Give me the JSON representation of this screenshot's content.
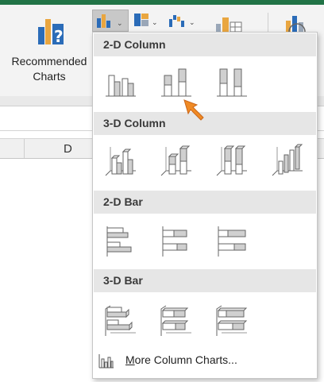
{
  "ribbon": {
    "recommended_line1": "Recommended",
    "recommended_line2": "Charts",
    "column_chart_caret": "⌄",
    "hierarchy_caret": "⌄",
    "waterfall_caret": "⌄"
  },
  "sheet": {
    "column_d": "D"
  },
  "dropdown": {
    "sections": [
      {
        "title": "2-D Column",
        "items": [
          "clustered-column-icon",
          "stacked-column-icon",
          "100-stacked-column-icon"
        ]
      },
      {
        "title": "3-D Column",
        "items": [
          "3d-clustered-column-icon",
          "3d-stacked-column-icon",
          "3d-100-stacked-column-icon",
          "3d-column-icon"
        ]
      },
      {
        "title": "2-D Bar",
        "items": [
          "clustered-bar-icon",
          "stacked-bar-icon",
          "100-stacked-bar-icon"
        ]
      },
      {
        "title": "3-D Bar",
        "items": [
          "3d-clustered-bar-icon",
          "3d-stacked-bar-icon",
          "3d-100-stacked-bar-icon"
        ]
      }
    ],
    "more_first_letter": "M",
    "more_rest": "ore Column Charts..."
  },
  "colors": {
    "brand": "#217346",
    "accent_orange": "#f08a24",
    "chart_blue": "#2b6cb8"
  }
}
